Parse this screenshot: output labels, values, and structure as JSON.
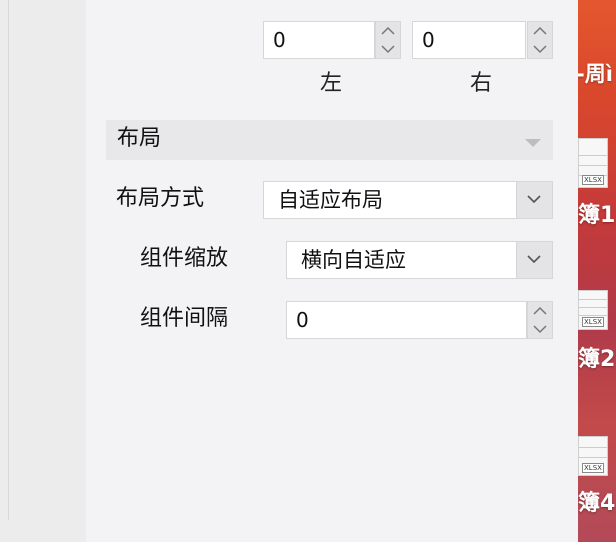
{
  "padding": {
    "left_value": "0",
    "right_value": "0",
    "left_label": "左",
    "right_label": "右"
  },
  "layout_section": {
    "title": "布局",
    "mode_label": "布局方式",
    "mode_value": "自适应布局",
    "scale_label": "组件缩放",
    "scale_value": "横向自适应",
    "gap_label": "组件间隔",
    "gap_value": "0"
  },
  "desktop": {
    "item_top_text": "-周ì",
    "thumb_labels": [
      "XLSX",
      "XLSX",
      "XLSX"
    ],
    "file_labels": [
      "簿1.",
      "簿2",
      "簿4"
    ]
  },
  "colors": {
    "panel_bg": "#f3f3f5",
    "section_bg": "#e8e8ea",
    "desktop_bg": "#d9472c"
  }
}
